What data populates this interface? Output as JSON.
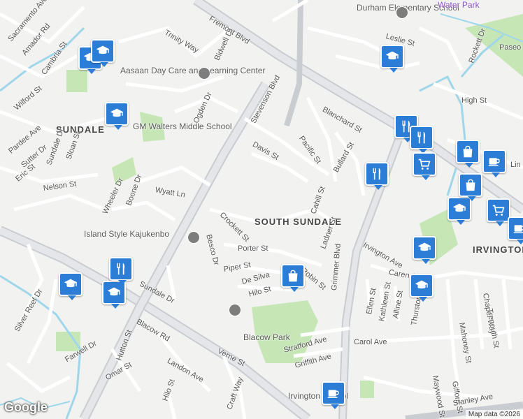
{
  "attribution": "Map data ©2026",
  "google_logo": "Google",
  "colors": {
    "education": "#2b7dd6",
    "road": "#ffffff",
    "arterial": "#c9ccd1",
    "park": "#c6e6b6",
    "water": "#9fd6ea",
    "land": "#f2f2f0"
  },
  "areas": [
    "SUNDALE",
    "SOUTH SUNDALE",
    "IRVINGTON"
  ],
  "pois": [
    "Durham Elementary School",
    "Aasaan Day Care and Learning Center",
    "GM Walters Middle School",
    "Island Style Kajukenbo",
    "Blacow Park",
    "Irvington School",
    "Water Park"
  ],
  "streets": [
    "Sacramento Ave",
    "Amador Rd",
    "Cambria St",
    "Trinity Way",
    "Bidwell Dr",
    "Fremont Blvd",
    "Stevenson Blvd",
    "Wilford St",
    "Pardee Ave",
    "Sutter Dr",
    "Sundale Dr",
    "Sloan St",
    "Eric St",
    "Nelson St",
    "Ogden Dr",
    "Wheeler Dr",
    "Boone Dr",
    "Wyatt Ln",
    "Davis St",
    "Crockett St",
    "Besco Dr",
    "Porter St",
    "Piper St",
    "De Silva",
    "Hilo St",
    "Robin St",
    "Cahill St",
    "Ladner St",
    "Pacific St",
    "Bullard St",
    "Blanchard St",
    "Grimmer Blvd",
    "Irvington Ave",
    "Caren St",
    "Kathleen St",
    "Ellen St",
    "Alline St",
    "Thurston St",
    "Chapel Way",
    "Leslie St",
    "Rockett Dr",
    "High St",
    "Silver Reef Dr",
    "Blacow Rd",
    "Sundale Dr",
    "Verne St",
    "Hutton St",
    "Farwell Dr",
    "Omar St",
    "Landon Ave",
    "Hilo St",
    "Carol Ave",
    "Stratford Ave",
    "Griffith Ave",
    "Mahoney St",
    "Gifford St",
    "Maywood St",
    "Trenouth St",
    "Stanley Ave",
    "Craft Way",
    "Paseo",
    "Lin"
  ],
  "markers": [
    {
      "icon": "school-icon"
    },
    {
      "icon": "school-icon"
    },
    {
      "icon": "school-icon"
    },
    {
      "icon": "school-icon"
    },
    {
      "icon": "school-icon"
    },
    {
      "icon": "school-icon"
    },
    {
      "icon": "school-icon"
    },
    {
      "icon": "school-icon"
    },
    {
      "icon": "school-icon"
    },
    {
      "icon": "restaurant-icon"
    },
    {
      "icon": "restaurant-icon"
    },
    {
      "icon": "restaurant-icon"
    },
    {
      "icon": "restaurant-icon"
    },
    {
      "icon": "shopping-bag-icon"
    },
    {
      "icon": "shopping-bag-icon"
    },
    {
      "icon": "shopping-bag-icon"
    },
    {
      "icon": "shopping-cart-icon"
    },
    {
      "icon": "shopping-cart-icon"
    },
    {
      "icon": "cafe-icon"
    },
    {
      "icon": "cafe-icon"
    },
    {
      "icon": "cafe-icon"
    }
  ]
}
